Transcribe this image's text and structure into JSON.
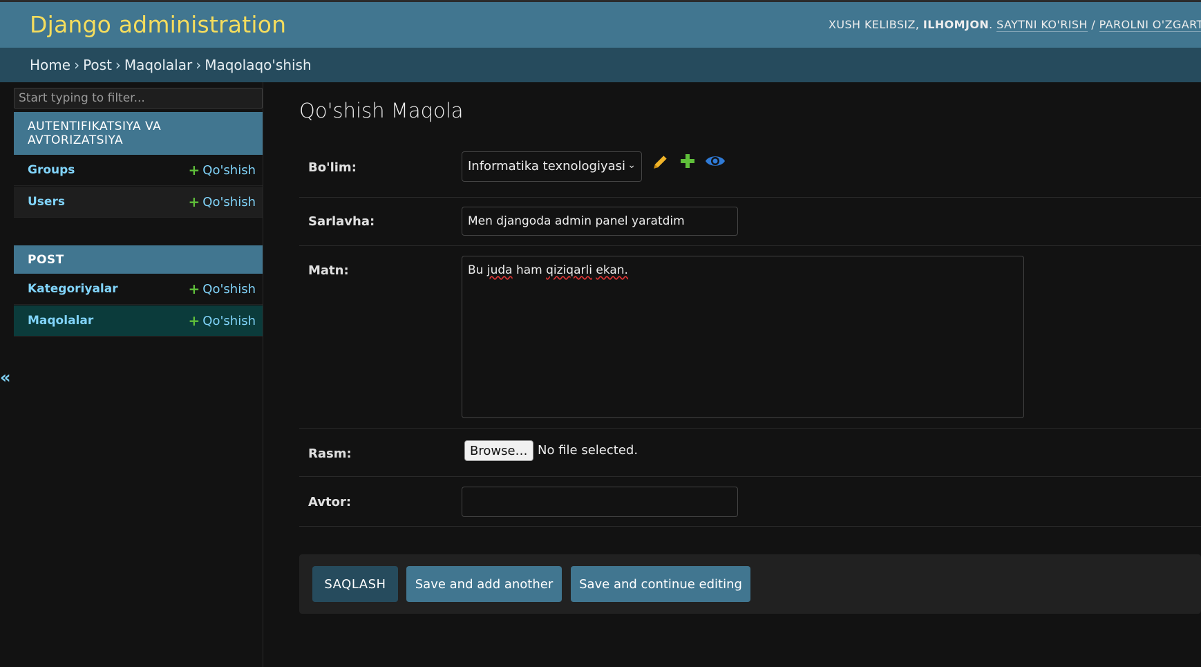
{
  "header": {
    "brand": "Django administration",
    "welcome": "XUSH KELIBSIZ,",
    "username": "ILHOMJON",
    "view_site": "SAYTNI KO'RISH",
    "separator": "/",
    "change_password": "PAROLNI O'ZGARTIRISH"
  },
  "breadcrumbs": {
    "items": [
      "Home",
      "Post",
      "Maqolalar",
      "Maqolaqo'shish"
    ],
    "sep": "›"
  },
  "sidebar": {
    "filter_placeholder": "Start typing to filter...",
    "collapse_glyph": "«",
    "modules": [
      {
        "caption": "AUTENTIFIKATSIYA VA AVTORIZATSIYA",
        "models": [
          {
            "name": "Groups",
            "add": "Qo'shish"
          },
          {
            "name": "Users",
            "add": "Qo'shish"
          }
        ]
      },
      {
        "caption": "POST",
        "models": [
          {
            "name": "Kategoriyalar",
            "add": "Qo'shish"
          },
          {
            "name": "Maqolalar",
            "add": "Qo'shish"
          }
        ]
      }
    ]
  },
  "form": {
    "title": "Qo'shish Maqola",
    "fields": {
      "bolim": {
        "label": "Bo'lim:",
        "value": "Informatika texnologiyasi"
      },
      "sarlavha": {
        "label": "Sarlavha:",
        "value": "Men djangoda admin panel yaratdim"
      },
      "matn": {
        "label": "Matn:",
        "value_words": [
          "Bu",
          "juda",
          "ham",
          "qiziqarli",
          "ekan."
        ]
      },
      "rasm": {
        "label": "Rasm:",
        "browse": "Browse…",
        "status": "No file selected."
      },
      "avtor": {
        "label": "Avtor:",
        "value": ""
      }
    },
    "related_icons": [
      "pencil-icon",
      "plus-icon",
      "eye-icon"
    ],
    "colors": {
      "edit": "#f0b429",
      "add": "#5fbf3a",
      "view": "#2f7ad6"
    }
  },
  "submit": {
    "save": "SAQLASH",
    "save_add": "Save and add another",
    "save_continue": "Save and continue editing"
  }
}
